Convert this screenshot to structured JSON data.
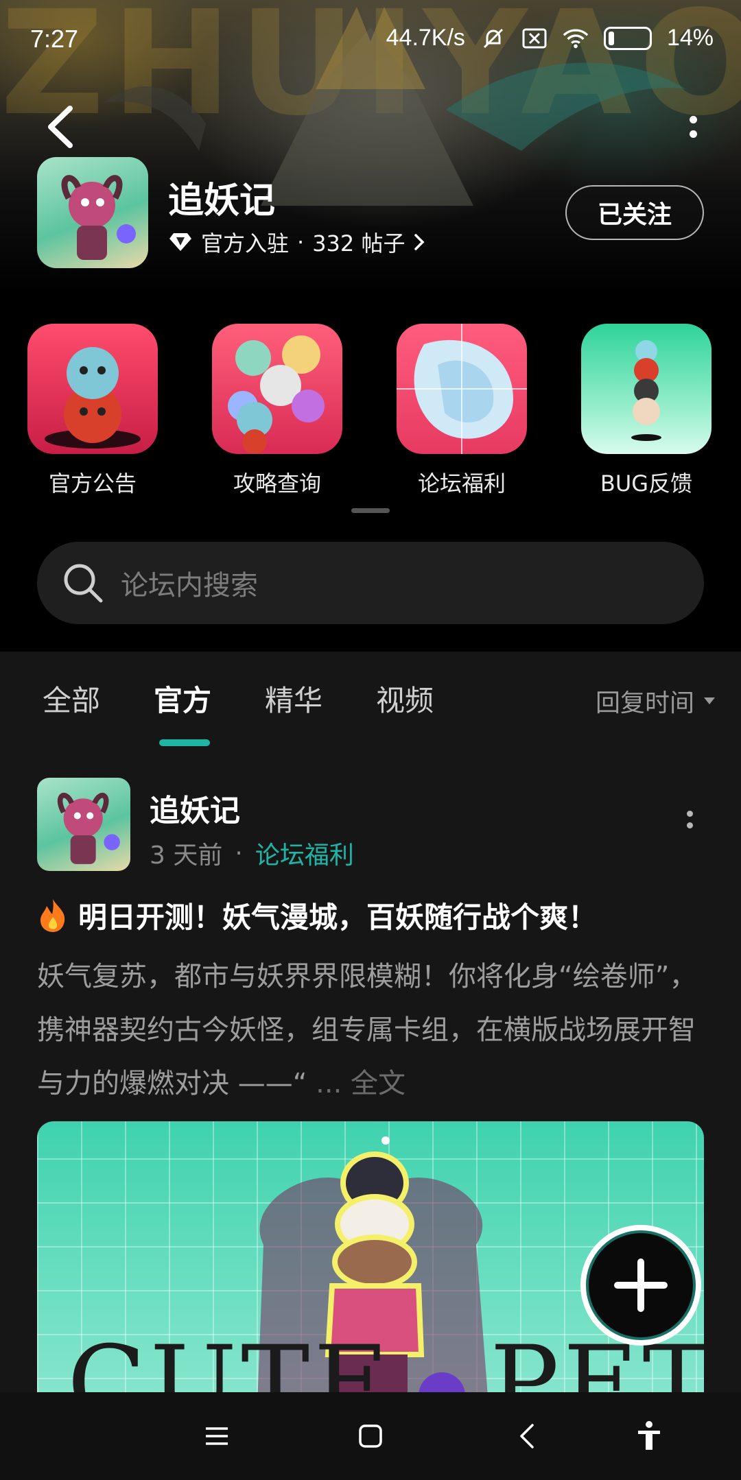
{
  "status_bar": {
    "time": "7:27",
    "network_speed": "44.7K/s",
    "battery": "14%",
    "icons": [
      "mute-icon",
      "no-sim-icon",
      "wifi-icon",
      "battery-icon"
    ]
  },
  "banner": {
    "decoration_text": "ZHUIYAOJI"
  },
  "game": {
    "title": "追妖记",
    "official_label": "官方入驻",
    "separator": "·",
    "post_count": "332 帖子",
    "follow_label": "已关注"
  },
  "quick_entries": [
    {
      "label": "官方公告",
      "icon": "announcement-image"
    },
    {
      "label": "攻略查询",
      "icon": "guide-image"
    },
    {
      "label": "论坛福利",
      "icon": "welfare-image"
    },
    {
      "label": "BUG反馈",
      "icon": "bug-feedback-image"
    }
  ],
  "search": {
    "placeholder": "论坛内搜索"
  },
  "tabs": {
    "items": [
      "全部",
      "官方",
      "精华",
      "视频"
    ],
    "active": "官方",
    "sort_label": "回复时间"
  },
  "post": {
    "author": "追妖记",
    "time": "3 天前",
    "separator": "·",
    "category": "论坛福利",
    "title": "明日开测！妖气漫城，百妖随行战个爽！",
    "body": "妖气复苏，都市与妖界界限模糊！你将化身“绘卷师”，携神器契约古今妖怪，组专属卡组，在横版战场展开智与力的爆燃对决 ——“",
    "more": "... 全文",
    "image_text_left": "CUTE",
    "image_text_right": "PETS"
  },
  "colors": {
    "accent": "#1fb5a5",
    "background": "#000000",
    "feed_background": "#161616"
  }
}
